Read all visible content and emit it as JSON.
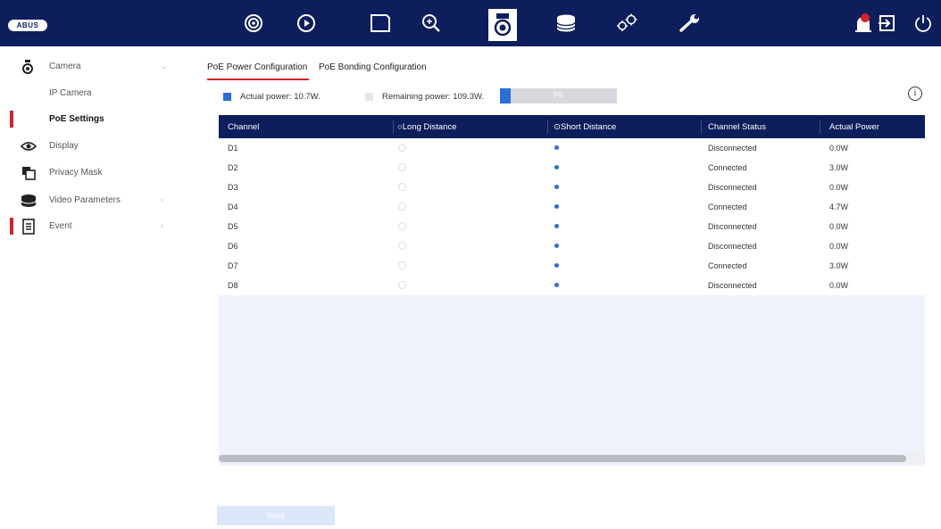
{
  "brand": {
    "logo": "ABUS"
  },
  "topnav": {
    "items": [
      "live-view",
      "playback",
      "file-management",
      "smart-search",
      "configuration",
      "storage",
      "system",
      "maintenance"
    ],
    "right": [
      "alarm-notification",
      "logout",
      "shutdown"
    ],
    "accent": "#0d1e5c"
  },
  "sidebar": {
    "items": [
      {
        "label": "Camera",
        "chevron": "⌄"
      },
      {
        "label": "IP Camera"
      },
      {
        "label": "PoE Settings"
      },
      {
        "label": "Display"
      },
      {
        "label": "Privacy Mask"
      },
      {
        "label": "Video Parameters",
        "chevron": "›"
      },
      {
        "label": "Event",
        "chevron": "›"
      }
    ]
  },
  "tabs": [
    "PoE Power Configuration",
    "PoE Bonding Configuration"
  ],
  "power": {
    "actual_label": "Actual power: 10.7W.",
    "remaining_label": "Remaining power: 109.3W.",
    "usage_text": "9%",
    "usage_fraction": 0.09,
    "actual_color": "#2a6ed6",
    "remaining_color": "#e4e6ea"
  },
  "table": {
    "headers": [
      "Channel",
      "Long Distance",
      "Short Distance",
      "Channel Status",
      "Actual Power"
    ],
    "rows": [
      {
        "channel": "D1",
        "long": false,
        "short": true,
        "status": "Disconnected",
        "power": "0.0W"
      },
      {
        "channel": "D2",
        "long": false,
        "short": true,
        "status": "Connected",
        "power": "3.0W"
      },
      {
        "channel": "D3",
        "long": false,
        "short": true,
        "status": "Disconnected",
        "power": "0.0W"
      },
      {
        "channel": "D4",
        "long": false,
        "short": true,
        "status": "Connected",
        "power": "4.7W"
      },
      {
        "channel": "D5",
        "long": false,
        "short": true,
        "status": "Disconnected",
        "power": "0.0W"
      },
      {
        "channel": "D6",
        "long": false,
        "short": true,
        "status": "Disconnected",
        "power": "0.0W"
      },
      {
        "channel": "D7",
        "long": false,
        "short": true,
        "status": "Connected",
        "power": "3.0W"
      },
      {
        "channel": "D8",
        "long": false,
        "short": true,
        "status": "Disconnected",
        "power": "0.0W"
      }
    ]
  },
  "buttons": {
    "save": "Save"
  }
}
